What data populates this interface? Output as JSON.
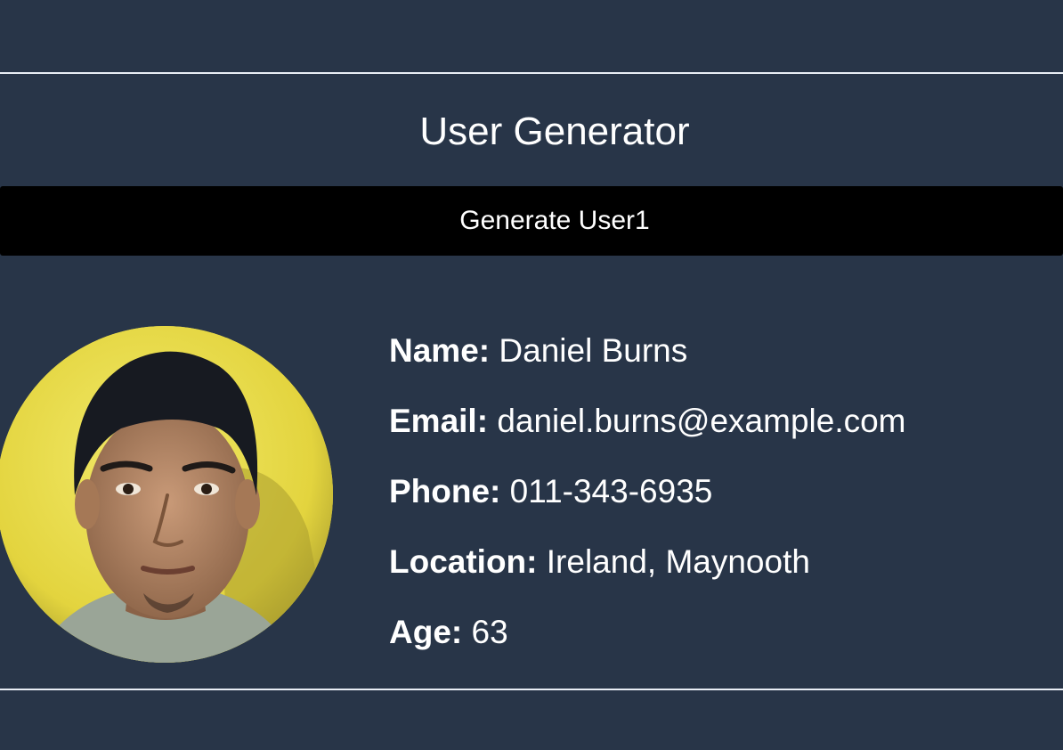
{
  "header": {
    "title": "User Generator"
  },
  "actions": {
    "generate_label": "Generate User1"
  },
  "user": {
    "fields": [
      {
        "label": "Name:",
        "value": "Daniel Burns"
      },
      {
        "label": "Email:",
        "value": "daniel.burns@example.com"
      },
      {
        "label": "Phone:",
        "value": "011-343-6935"
      },
      {
        "label": "Location:",
        "value": "Ireland, Maynooth"
      },
      {
        "label": "Age:",
        "value": "63"
      }
    ]
  },
  "colors": {
    "background": "#283548",
    "button": "#000000",
    "text": "#ffffff",
    "divider": "#e9eef5"
  }
}
